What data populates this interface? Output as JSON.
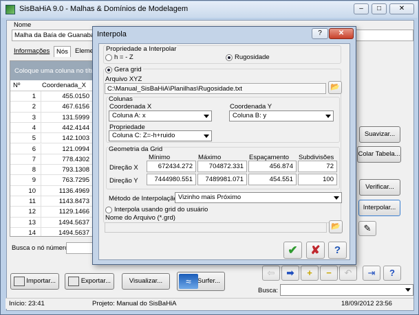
{
  "app": {
    "title": "SisBaHiA 9.0 - Malhas & Domínios de Modelagem",
    "window_buttons": [
      "–",
      "□",
      "✕"
    ]
  },
  "main": {
    "name_label": "Nome",
    "name_value": "Malha da Baía de Guanabara",
    "tabs": [
      "Informações",
      "Nós",
      "Eleme"
    ],
    "grid_hint": "Coloque uma coluna no título",
    "grid_headers": [
      "Nº",
      "Coordenada_X"
    ],
    "rows": [
      {
        "n": "1",
        "x": "455.0150"
      },
      {
        "n": "2",
        "x": "467.6156"
      },
      {
        "n": "3",
        "x": "131.5999"
      },
      {
        "n": "4",
        "x": "442.4144"
      },
      {
        "n": "5",
        "x": "142.1003"
      },
      {
        "n": "6",
        "x": "121.0994"
      },
      {
        "n": "7",
        "x": "778.4302"
      },
      {
        "n": "8",
        "x": "793.1308"
      },
      {
        "n": "9",
        "x": "763.7295"
      },
      {
        "n": "10",
        "x": "1136.4969"
      },
      {
        "n": "11",
        "x": "1143.8473"
      },
      {
        "n": "12",
        "x": "1129.1466"
      },
      {
        "n": "13",
        "x": "1494.5637"
      },
      {
        "n": "14",
        "x": "1494.5637"
      }
    ],
    "search_node_label": "Busca o nó número:",
    "right_buttons": [
      "Suavizar...",
      "Colar Tabela...",
      "Verificar...",
      "Interpolar..."
    ],
    "bottom_buttons": {
      "import": "Importar...",
      "export": "Exportar...",
      "visualize": "Visualizar...",
      "surfer": "Surfer..."
    },
    "search_label": "Busca:"
  },
  "status": {
    "start": "Início: 23:41",
    "project": "Projeto: Manual do SisBaHiA",
    "date": "18/09/2012 23:56"
  },
  "dialog": {
    "title": "Interpola",
    "help_btn": "?",
    "close_btn": "✕",
    "prop_group": "Propriedade a Interpolar",
    "radio_h": "h = - Z",
    "radio_rug": "Rugosidade",
    "gera_grid": "Gera grid",
    "arquivo_label": "Arquivo XYZ",
    "arquivo_value": "C:\\Manual_SisBaHiA\\Planilhas\\Rugosidade.txt",
    "colunas_label": "Colunas",
    "coord_x_label": "Coordenada X",
    "coord_x_value": "Coluna A: x",
    "coord_y_label": "Coordenada Y",
    "coord_y_value": "Coluna B: y",
    "propriedade_label": "Propriedade",
    "propriedade_value": "Coluna C: Z=-h+ruido",
    "geometria_label": "Geometria da Grid",
    "geo_headers": [
      "Mínimo",
      "Máximo",
      "Espaçamento",
      "Subdivisões"
    ],
    "dir_x_label": "Direção X",
    "dir_x": [
      "672434.272",
      "704872.331",
      "456.874",
      "72"
    ],
    "dir_y_label": "Direção Y",
    "dir_y": [
      "7444980.551",
      "7489981.071",
      "454.551",
      "100"
    ],
    "metodo_label": "Método de Interpolação:",
    "metodo_value": "Vizinho mais Próximo",
    "user_grid_label": "Interpola usando grid do usuário",
    "nome_arquivo_label": "Nome do Arquivo (*.grd)",
    "ok": "✔",
    "cancel": "✘",
    "help": "?"
  },
  "colors": {
    "window_frame": "#bcd0e8",
    "grid_header_bg": "#9aa9b8",
    "ok_green": "#2f9a2f",
    "cancel_red": "#c0282e",
    "help_blue": "#1f55b5"
  }
}
